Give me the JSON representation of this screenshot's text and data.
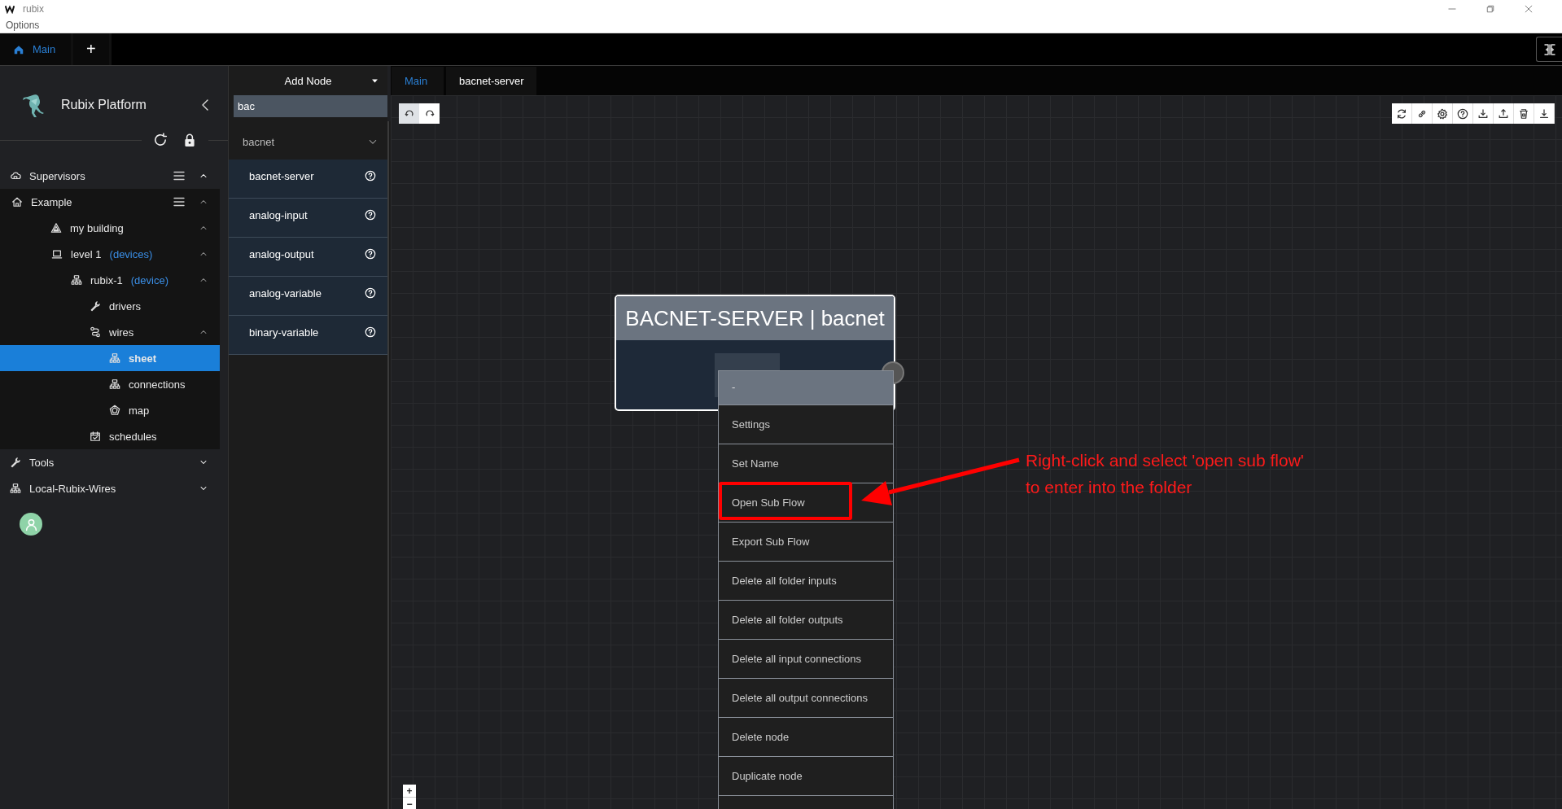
{
  "window": {
    "title": "rubix",
    "menu": [
      "Options"
    ]
  },
  "app_tabs": [
    {
      "label": "Main",
      "kind": "home",
      "selected": true
    },
    {
      "label": "+",
      "kind": "add",
      "selected": false
    }
  ],
  "sidebar": {
    "title": "Rubix Platform",
    "tree": [
      {
        "label": "Supervisors",
        "kind": "supervisor",
        "has_menu": true,
        "expanded": true,
        "selected": false,
        "children": [
          {
            "label": "Example",
            "kind": "location",
            "has_menu": true,
            "expanded": true,
            "selected": false,
            "children": [
              {
                "label": "my building",
                "kind": "site",
                "expanded": true,
                "selected": false,
                "children": [
                  {
                    "label": "level 1",
                    "tag": "(devices)",
                    "kind": "network",
                    "expanded": true,
                    "selected": false,
                    "children": [
                      {
                        "label": "rubix-1",
                        "tag": "(device)",
                        "kind": "device",
                        "expanded": true,
                        "selected": false,
                        "children": [
                          {
                            "label": "drivers",
                            "kind": "drivers",
                            "selected": false
                          },
                          {
                            "label": "wires",
                            "kind": "wires",
                            "expanded": true,
                            "selected": false,
                            "children": [
                              {
                                "label": "sheet",
                                "kind": "sheet",
                                "selected": true
                              },
                              {
                                "label": "connections",
                                "kind": "sheet",
                                "selected": false
                              },
                              {
                                "label": "map",
                                "kind": "map",
                                "selected": false
                              }
                            ]
                          },
                          {
                            "label": "schedules",
                            "kind": "schedules",
                            "selected": false
                          }
                        ]
                      }
                    ]
                  }
                ]
              }
            ]
          }
        ]
      },
      {
        "label": "Tools",
        "kind": "tools",
        "expanded": false,
        "selected": false
      },
      {
        "label": "Local-Rubix-Wires",
        "kind": "flow",
        "expanded": false,
        "selected": false
      }
    ]
  },
  "node_panel": {
    "title": "Add Node",
    "search": {
      "value": "bac"
    },
    "groups": [
      {
        "label": "bacnet",
        "expanded": true,
        "items": [
          {
            "label": "bacnet-server"
          },
          {
            "label": "analog-input"
          },
          {
            "label": "analog-output"
          },
          {
            "label": "analog-variable"
          },
          {
            "label": "binary-variable"
          }
        ]
      }
    ]
  },
  "canvas_tabs": [
    {
      "label": "Main",
      "selected": true
    },
    {
      "label": "bacnet-server",
      "selected": false
    }
  ],
  "node": {
    "title": "BACNET-SERVER | bacnet"
  },
  "context_menu": {
    "header": "-",
    "items": [
      {
        "label": "Settings",
        "highlighted": false
      },
      {
        "label": "Set Name",
        "highlighted": false
      },
      {
        "label": "Open Sub Flow",
        "highlighted": true
      },
      {
        "label": "Export Sub Flow",
        "highlighted": false
      },
      {
        "label": "Delete all folder inputs",
        "highlighted": false
      },
      {
        "label": "Delete all folder outputs",
        "highlighted": false
      },
      {
        "label": "Delete all input connections",
        "highlighted": false
      },
      {
        "label": "Delete all output connections",
        "highlighted": false
      },
      {
        "label": "Delete node",
        "highlighted": false
      },
      {
        "label": "Duplicate node",
        "highlighted": false
      }
    ]
  },
  "annotation": {
    "text": "Right-click and select 'open sub flow'\nto enter into the folder"
  },
  "zoom_controls": [
    "+",
    "−"
  ]
}
